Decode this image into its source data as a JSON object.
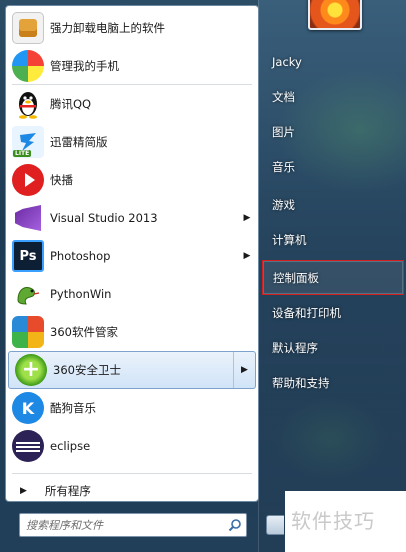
{
  "start_menu": {
    "programs": [
      {
        "label": "强力卸载电脑上的软件",
        "icon": "uninstall-icon",
        "submenu": false
      },
      {
        "label": "管理我的手机",
        "icon": "phone-manager-icon",
        "submenu": false
      },
      {
        "label": "腾讯QQ",
        "icon": "qq-penguin-icon",
        "submenu": false
      },
      {
        "label": "迅雷精简版",
        "icon": "thunder-lite-icon",
        "submenu": false
      },
      {
        "label": "快播",
        "icon": "kuaibo-play-icon",
        "submenu": false
      },
      {
        "label": "Visual Studio 2013",
        "icon": "visual-studio-icon",
        "submenu": true
      },
      {
        "label": "Photoshop",
        "icon": "photoshop-icon",
        "submenu": true
      },
      {
        "label": "PythonWin",
        "icon": "python-icon",
        "submenu": false
      },
      {
        "label": "360软件管家",
        "icon": "360-software-manager-icon",
        "submenu": false
      },
      {
        "label": "360安全卫士",
        "icon": "360-safeguard-icon",
        "submenu": true,
        "selected": true
      },
      {
        "label": "酷狗音乐",
        "icon": "kugou-music-icon",
        "submenu": false
      },
      {
        "label": "eclipse",
        "icon": "eclipse-icon",
        "submenu": false
      }
    ],
    "all_programs_label": "所有程序",
    "search": {
      "placeholder": "搜索程序和文件"
    },
    "user_name": "Jacky",
    "places": [
      {
        "label": "文档"
      },
      {
        "label": "图片"
      },
      {
        "label": "音乐"
      },
      {
        "label": "游戏"
      },
      {
        "label": "计算机"
      },
      {
        "label": "控制面板",
        "highlighted": true
      },
      {
        "label": "设备和打印机"
      },
      {
        "label": "默认程序"
      },
      {
        "label": "帮助和支持"
      }
    ],
    "highlight_color": "#d41d1d",
    "selected_row_color": "#d1e4f8"
  },
  "watermark": {
    "text": "软件技巧"
  }
}
